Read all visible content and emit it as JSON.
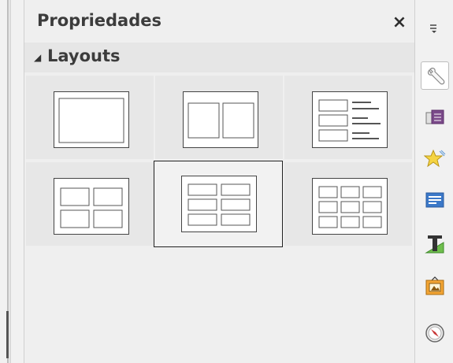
{
  "panel": {
    "title": "Propriedades",
    "close_symbol": "×"
  },
  "section": {
    "arrow": "◢",
    "title": "Layouts"
  },
  "layouts": [
    {
      "name": "blank"
    },
    {
      "name": "two-columns"
    },
    {
      "name": "title-content-list"
    },
    {
      "name": "four-blocks"
    },
    {
      "name": "six-blocks-2x3",
      "selected": true
    },
    {
      "name": "nine-blocks"
    }
  ],
  "tabs": [
    {
      "icon": "wrench-icon",
      "active": true
    },
    {
      "icon": "slide-transition-icon"
    },
    {
      "icon": "star-animation-icon"
    },
    {
      "icon": "master-slides-icon"
    },
    {
      "icon": "styles-icon"
    },
    {
      "icon": "gallery-icon"
    },
    {
      "icon": "navigator-icon"
    }
  ]
}
